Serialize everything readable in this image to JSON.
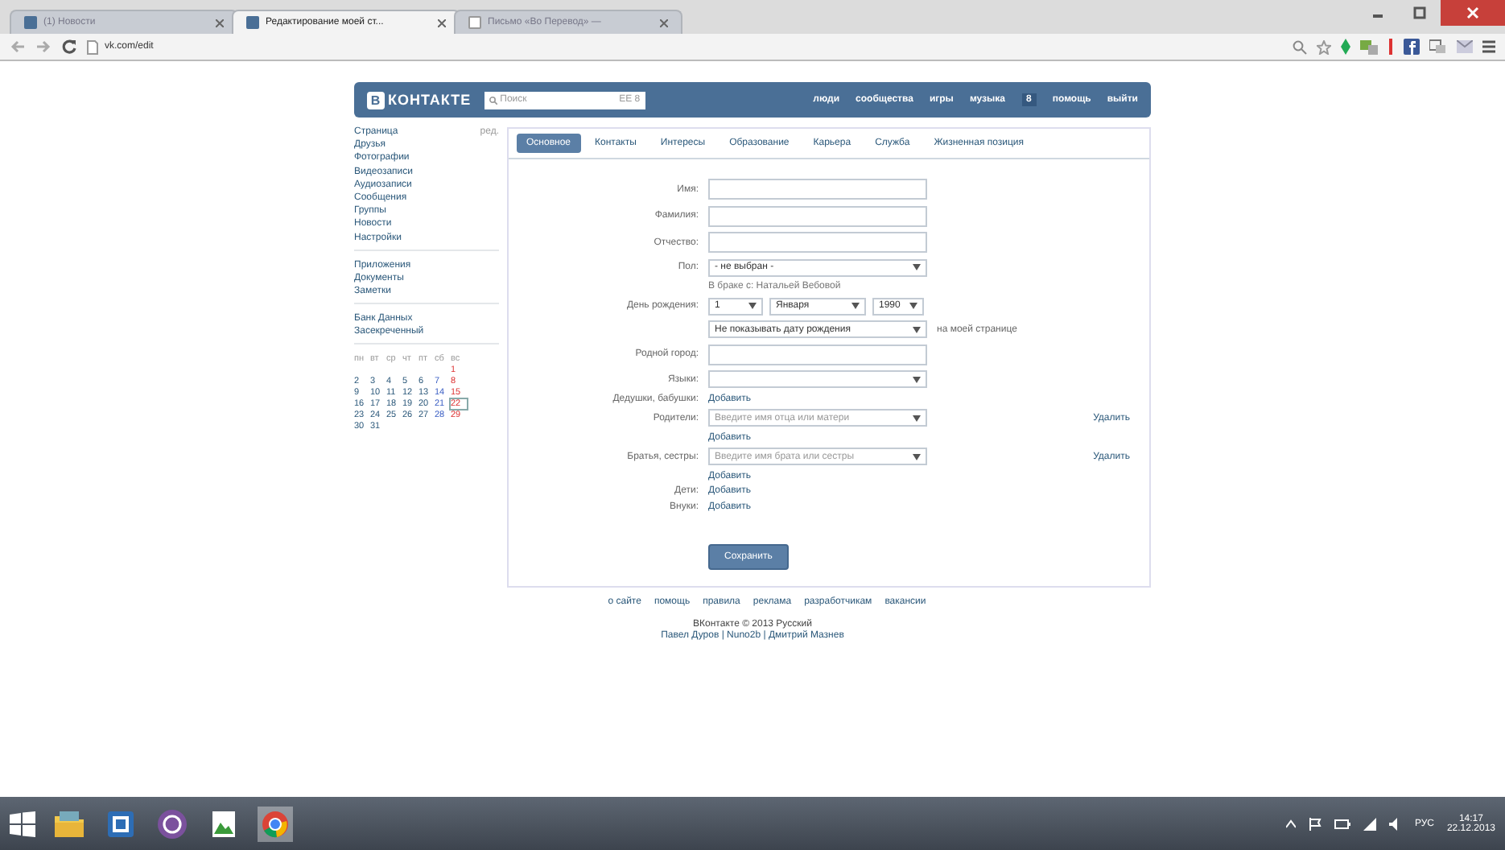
{
  "browser": {
    "tabs": [
      {
        "title": "(1) Новости",
        "selected": false
      },
      {
        "title": "Редактирование моей ст...",
        "selected": true
      },
      {
        "title": "Письмо «Во Перевод» —",
        "selected": false
      }
    ],
    "url": "vk.com/edit"
  },
  "vk": {
    "header": {
      "logo_letter": "В",
      "logo_text": "КОНТАКТЕ",
      "search_placeholder": "Поиск",
      "search_hint": "EE 8",
      "nav": [
        {
          "label": "люди"
        },
        {
          "label": "сообщества"
        },
        {
          "label": "игры"
        },
        {
          "label": "музыка"
        },
        {
          "label": "8",
          "kind": "badge"
        },
        {
          "label": "помощь"
        },
        {
          "label": "выйти"
        }
      ]
    },
    "sidebar": {
      "edit_link": "ред.",
      "groups": [
        [
          "Страница",
          "Друзья",
          "Фотографии",
          "Видеозаписи",
          "Аудиозаписи",
          "Сообщения",
          "Группы",
          "Новости",
          "Настройки"
        ],
        [
          "Приложения",
          "Документы",
          "Заметки"
        ],
        [
          "Банк Данных",
          "Засекреченный"
        ]
      ]
    },
    "calendar": {
      "weekdays": [
        "пн",
        "вт",
        "ср",
        "чт",
        "пт",
        "сб",
        "вс"
      ],
      "weeks": [
        [
          {
            "day": "1",
            "today": false
          }
        ],
        [
          {
            "day": "2",
            "today": false
          },
          {
            "day": "3",
            "today": false
          },
          {
            "day": "4",
            "today": false
          },
          {
            "day": "5",
            "today": false
          },
          {
            "day": "6",
            "today": false
          },
          {
            "day": "7",
            "today": false
          },
          {
            "day": "8",
            "today": false
          }
        ],
        [
          {
            "day": "9",
            "today": false
          },
          {
            "day": "10",
            "today": false
          },
          {
            "day": "11",
            "today": false
          },
          {
            "day": "12",
            "today": false
          },
          {
            "day": "13",
            "today": false
          },
          {
            "day": "14",
            "today": false
          },
          {
            "day": "15",
            "today": false
          }
        ],
        [
          {
            "day": "16",
            "today": false
          },
          {
            "day": "17",
            "today": false
          },
          {
            "day": "18",
            "today": false
          },
          {
            "day": "19",
            "today": false
          },
          {
            "day": "20",
            "today": false
          },
          {
            "day": "21",
            "today": false
          },
          {
            "day": "22",
            "today": true
          }
        ],
        [
          {
            "day": "23",
            "today": false
          },
          {
            "day": "24",
            "today": false
          },
          {
            "day": "25",
            "today": false
          },
          {
            "day": "26",
            "today": false
          },
          {
            "day": "27",
            "today": false
          },
          {
            "day": "28",
            "today": false
          },
          {
            "day": "29",
            "today": false
          }
        ],
        [
          {
            "day": "30",
            "today": false
          },
          {
            "day": "31",
            "today": false
          }
        ]
      ]
    },
    "tabs": [
      {
        "label": "Основное",
        "selected": true
      },
      {
        "label": "Контакты",
        "selected": false
      },
      {
        "label": "Интересы",
        "selected": false
      },
      {
        "label": "Образование",
        "selected": false
      },
      {
        "label": "Карьера",
        "selected": false
      },
      {
        "label": "Служба",
        "selected": false
      },
      {
        "label": "Жизненная позиция",
        "selected": false
      }
    ],
    "form": [
      {
        "kind": "input",
        "label": "Имя:"
      },
      {
        "kind": "input",
        "label": "Фамилия:"
      },
      {
        "kind": "input",
        "label": "Отчество:"
      },
      {
        "kind": "select",
        "label": "Пол:",
        "value": "- не выбран -"
      },
      {
        "kind": "note",
        "text": "В браке с: Натальей Вебовой"
      },
      {
        "kind": "date",
        "label": "День рождения:",
        "values": [
          "1",
          "Января",
          "1990"
        ]
      },
      {
        "kind": "select",
        "value": "Не показывать дату рождения",
        "aside": "на моей странице"
      },
      {
        "kind": "input",
        "label": "Родной город:"
      },
      {
        "kind": "select",
        "label": "Языки:"
      },
      {
        "kind": "link",
        "label": "Дедушки, бабушки:",
        "link": "Добавить"
      },
      {
        "kind": "relative",
        "label": "Родители:",
        "placeholder": "Введите имя отца или матери",
        "remove": "Удалить",
        "link": "Добавить"
      },
      {
        "kind": "relative",
        "label": "Братья, сестры:",
        "placeholder": "Введите имя брата или сестры",
        "remove": "Удалить",
        "link": "Добавить"
      },
      {
        "kind": "link",
        "label": "Дети:",
        "link": "Добавить"
      },
      {
        "kind": "link",
        "label": "Внуки:",
        "link": "Добавить"
      }
    ],
    "save_button": "Сохранить",
    "footer": {
      "links": [
        "о сайте",
        "помощь",
        "правила",
        "реклама",
        "разработчикам",
        "вакансии"
      ],
      "copyright": "ВКонтакте © 2013 Русский",
      "authors": "Павел Дуров | Nuno2b | Дмитрий Мазнев"
    }
  },
  "taskbar": {
    "language": "РУС",
    "time": "14:17",
    "date": "22.12.2013"
  }
}
